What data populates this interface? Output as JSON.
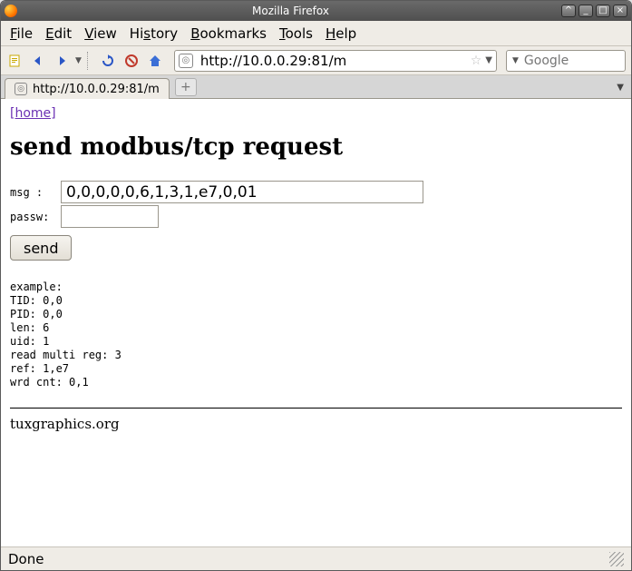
{
  "window": {
    "title": "Mozilla Firefox"
  },
  "menubar": {
    "items": [
      {
        "ul": "F",
        "rest": "ile"
      },
      {
        "ul": "E",
        "rest": "dit"
      },
      {
        "ul": "V",
        "rest": "iew"
      },
      {
        "pre": "Hi",
        "ul": "s",
        "rest": "tory"
      },
      {
        "ul": "B",
        "rest": "ookmarks"
      },
      {
        "ul": "T",
        "rest": "ools"
      },
      {
        "ul": "H",
        "rest": "elp"
      }
    ]
  },
  "url": "http://10.0.0.29:81/m",
  "search": {
    "placeholder": "Google"
  },
  "tab": {
    "label": "http://10.0.0.29:81/m"
  },
  "page": {
    "home_link": "[home]",
    "heading": "send modbus/tcp request",
    "msg_label": "msg  :",
    "msg_value": "0,0,0,0,0,6,1,3,1,e7,0,01",
    "passw_label": "passw:",
    "passw_value": "",
    "send_label": "send",
    "example": "example:\nTID: 0,0\nPID: 0,0\nlen: 6\nuid: 1\nread multi reg: 3\nref: 1,e7\nwrd cnt: 0,1",
    "footer": "tuxgraphics.org"
  },
  "status": {
    "text": "Done"
  }
}
